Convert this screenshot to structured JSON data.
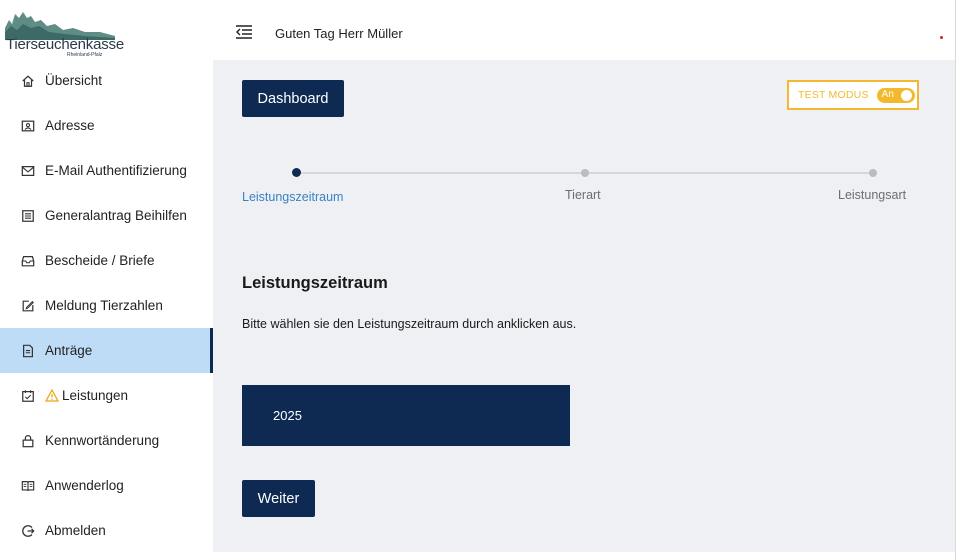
{
  "logo": {
    "name": "Tierseuchenkasse",
    "sub": "Rheinland-Pfalz"
  },
  "sidebar": {
    "items": [
      {
        "label": "Übersicht",
        "icon": "home-icon"
      },
      {
        "label": "Adresse",
        "icon": "address-card-icon"
      },
      {
        "label": "E-Mail Authentifizierung",
        "icon": "mail-icon"
      },
      {
        "label": "Generalantrag Beihilfen",
        "icon": "form-icon"
      },
      {
        "label": "Bescheide / Briefe",
        "icon": "inbox-icon"
      },
      {
        "label": "Meldung Tierzahlen",
        "icon": "edit-icon"
      },
      {
        "label": "Anträge",
        "icon": "file-icon",
        "active": true
      },
      {
        "label": "Leistungen",
        "icon": "calendar-check-icon",
        "warning": true
      },
      {
        "label": "Kennwortänderung",
        "icon": "lock-icon"
      },
      {
        "label": "Anwenderlog",
        "icon": "book-icon"
      },
      {
        "label": "Abmelden",
        "icon": "logout-icon"
      }
    ]
  },
  "header": {
    "greeting": "Guten Tag Herr Müller"
  },
  "main": {
    "dashboard_label": "Dashboard",
    "test_mode": {
      "label": "TEST MODUS",
      "state": "An"
    },
    "steps": [
      {
        "label": "Leistungszeitraum",
        "active": true
      },
      {
        "label": "Tierart",
        "active": false
      },
      {
        "label": "Leistungsart",
        "active": false
      }
    ],
    "section_title": "Leistungszeitraum",
    "section_desc": "Bitte wählen sie den Leistungszeitraum durch anklicken aus.",
    "year_option": "2025",
    "next_label": "Weiter"
  },
  "colors": {
    "primary": "#0f2a52",
    "active_nav_bg": "#bfdcf7",
    "accent_yellow": "#f2b92f",
    "step_active_text": "#3a82c4",
    "content_bg": "#eef0f4"
  }
}
